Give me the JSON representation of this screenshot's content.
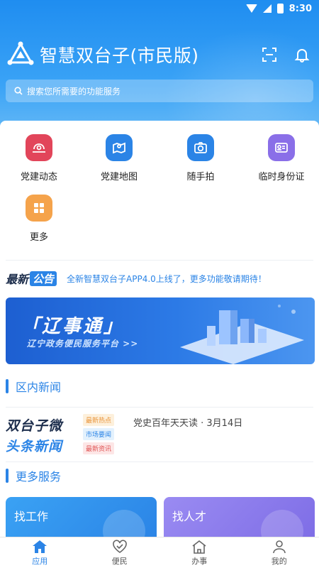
{
  "status_bar": {
    "time": "8:30"
  },
  "header": {
    "title": "智慧双台子(市民版)",
    "search_placeholder": "搜索您所需要的功能服务"
  },
  "grid": {
    "items": [
      {
        "label": "党建动态",
        "icon": "party-news-icon",
        "color": "#e2455a"
      },
      {
        "label": "党建地图",
        "icon": "map-icon",
        "color": "#2b84e6"
      },
      {
        "label": "随手拍",
        "icon": "camera-icon",
        "color": "#2b84e6"
      },
      {
        "label": "临时身份证",
        "icon": "id-card-icon",
        "color": "#8a6fe8"
      },
      {
        "label": "更多",
        "icon": "more-grid-icon",
        "color": "#f5a34b"
      }
    ]
  },
  "notice": {
    "badge_a": "最新",
    "badge_b": "公告",
    "text": "全新智慧双台子APP4.0上线了，更多功能敬请期待！"
  },
  "banner": {
    "title": "「辽事通」",
    "subtitle": "辽宁政务便民服务平台 >>"
  },
  "district_news": {
    "title": "区内新闻",
    "brand_line1": "双台子微",
    "brand_line2": "头条新闻",
    "tags": [
      "最新热点",
      "市场要闻",
      "最新资讯"
    ],
    "headline": "党史百年天天读 · 3月14日"
  },
  "more_services": {
    "title": "更多服务",
    "cards": [
      {
        "label": "找工作",
        "color": "#2b84e6"
      },
      {
        "label": "找人才",
        "color": "#8a6fe8"
      }
    ]
  },
  "tab_bar": {
    "tabs": [
      {
        "label": "应用",
        "icon": "home-icon",
        "active": true
      },
      {
        "label": "便民",
        "icon": "heart-icon",
        "active": false
      },
      {
        "label": "办事",
        "icon": "building-icon",
        "active": false
      },
      {
        "label": "我的",
        "icon": "user-icon",
        "active": false
      }
    ]
  },
  "colors": {
    "primary": "#2b84e6",
    "header_top": "#1f8df0"
  }
}
